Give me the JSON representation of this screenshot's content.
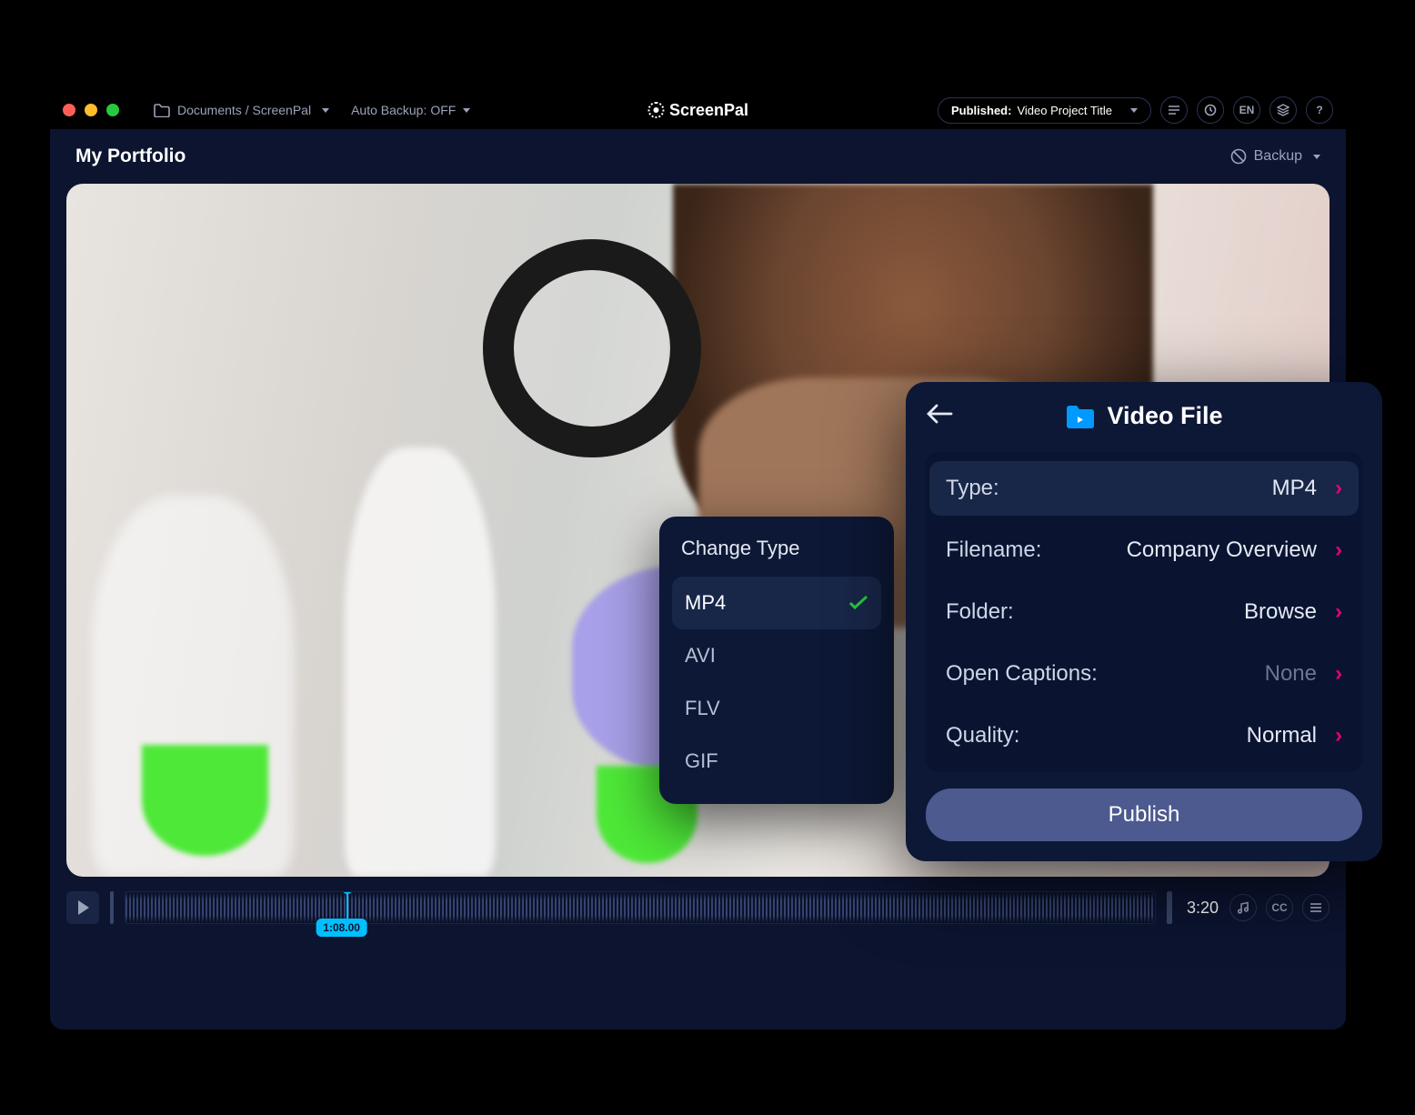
{
  "titlebar": {
    "folder_path": "Documents / ScreenPal",
    "auto_backup_label": "Auto Backup:",
    "auto_backup_value": "OFF",
    "brand": "ScreenPal",
    "published_label": "Published:",
    "published_value": "Video Project Title",
    "en_label": "EN",
    "help_label": "?"
  },
  "subheader": {
    "title": "My Portfolio",
    "backup_label": "Backup"
  },
  "timeline": {
    "playhead_time": "1:08.00",
    "total_time": "3:20",
    "cc_label": "CC"
  },
  "change_type": {
    "title": "Change Type",
    "options": [
      "MP4",
      "AVI",
      "FLV",
      "GIF"
    ],
    "selected": "MP4"
  },
  "video_file": {
    "title": "Video File",
    "rows": {
      "type_label": "Type:",
      "type_value": "MP4",
      "filename_label": "Filename:",
      "filename_value": "Company Overview",
      "folder_label": "Folder:",
      "folder_value": "Browse",
      "captions_label": "Open Captions:",
      "captions_value": "None",
      "quality_label": "Quality:",
      "quality_value": "Normal"
    },
    "publish_label": "Publish"
  }
}
